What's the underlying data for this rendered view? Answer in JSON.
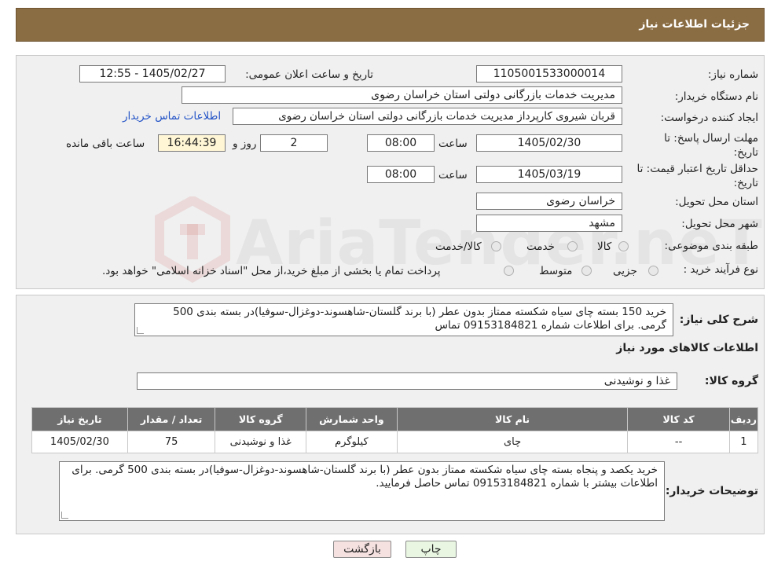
{
  "header": {
    "title": "جزئیات اطلاعات نیاز"
  },
  "form": {
    "need_number_label": "شماره نیاز:",
    "need_number": "1105001533000014",
    "announce_label": "تاریخ و ساعت اعلان عمومی:",
    "announce_value": "1405/02/27 - 12:55",
    "buyer_org_label": "نام دستگاه خریدار:",
    "buyer_org": "مدیریت خدمات بازرگانی دولتی استان خراسان رضوی",
    "creator_label": "ایجاد کننده درخواست:",
    "creator": "قربان شیروی کارپرداز مدیریت خدمات بازرگانی دولتی استان خراسان رضوی",
    "contact_link": "اطلاعات تماس خریدار",
    "reply_deadline_label": "مهلت ارسال پاسخ: تا تاریخ:",
    "reply_date": "1405/02/30",
    "time_label": "ساعت",
    "reply_time": "08:00",
    "days_value": "2",
    "days_label": "روز و",
    "remaining_time": "16:44:39",
    "remaining_label": "ساعت باقی مانده",
    "price_validity_label": "حداقل تاریخ اعتبار قیمت: تا تاریخ:",
    "price_date": "1405/03/19",
    "price_time": "08:00",
    "province_label": "استان محل تحویل:",
    "province": "خراسان رضوی",
    "city_label": "شهر محل تحویل:",
    "city": "مشهد",
    "category_label": "طبقه بندی موضوعی:",
    "category_options": [
      "کالا",
      "خدمت",
      "کالا/خدمت"
    ],
    "process_label": "نوع فرآیند خرید :",
    "process_options": [
      "جزیی",
      "متوسط"
    ],
    "process_note": "پرداخت تمام یا بخشی از مبلغ خرید،از محل \"اسناد خزانه اسلامی\" خواهد بود."
  },
  "summary": {
    "label": "شرح کلی نیاز:",
    "text": "خرید 150 بسته چای سیاه شکسته ممتاز بدون عطر (با برند گلستان-شاهسوند-دوغزال-سوفیا)در بسته بندی 500 گرمی. برای اطلاعات  شماره 09153184821 تماس",
    "goods_info_title": "اطلاعات کالاهای مورد نیاز",
    "goods_group_label": "گروه کالا:",
    "goods_group": "غذا و نوشیدنی"
  },
  "table": {
    "headers": [
      "ردیف",
      "کد کالا",
      "نام کالا",
      "واحد شمارش",
      "گروه کالا",
      "تعداد / مقدار",
      "تاریخ نیاز"
    ],
    "rows": [
      [
        "1",
        "--",
        "چای",
        "کیلوگرم",
        "غذا و نوشیدنی",
        "75",
        "1405/02/30"
      ]
    ]
  },
  "buyer_notes": {
    "label": "توضیحات خریدار:",
    "text": "خرید یکصد و پنجاه بسته چای سیاه شکسته ممتاز بدون عطر (با برند گلستان-شاهسوند-دوغزال-سوفیا)در بسته بندی 500 گرمی. برای اطلاعات بیشتر با شماره 09153184821 تماس حاصل فرمایید."
  },
  "buttons": {
    "print": "چاپ",
    "back": "بازگشت"
  },
  "watermark": {
    "text": "AriaTender.neT"
  },
  "colors": {
    "header_bg": "#8b6d43",
    "link": "#2454c7",
    "table_header": "#6f6f6f"
  }
}
